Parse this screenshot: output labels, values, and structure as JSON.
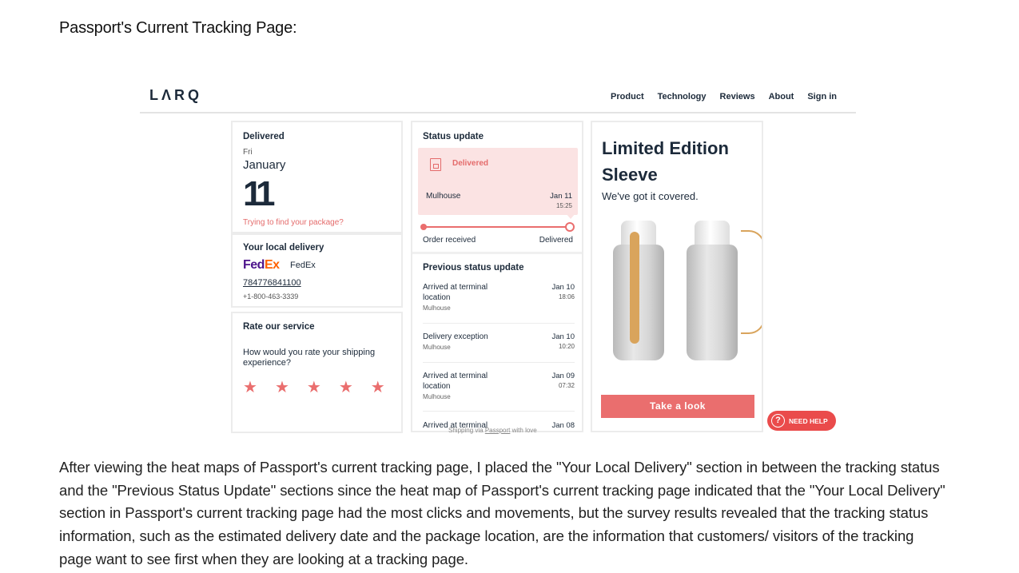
{
  "heading": "Passport's Current Tracking Page:",
  "site": {
    "logo": "LΛRQ",
    "nav": [
      "Product",
      "Technology",
      "Reviews",
      "About",
      "Sign in"
    ]
  },
  "delivered_card": {
    "title": "Delivered",
    "day": "Fri",
    "month": "January",
    "date": "11",
    "help_link": "Trying to find your package?"
  },
  "local_delivery": {
    "title": "Your local delivery",
    "carrier_logo_fe": "Fed",
    "carrier_logo_ex": "Ex",
    "carrier_name": "FedEx",
    "tracking_number": "784776841100",
    "phone": "+1-800-463-3339"
  },
  "rating": {
    "title": "Rate our service",
    "question": "How would you rate your shipping experience?",
    "stars": 5
  },
  "status": {
    "title": "Status update",
    "current_label": "Delivered",
    "location": "Mulhouse",
    "date": "Jan 11",
    "time": "15:25",
    "progress_start": "Order received",
    "progress_end": "Delivered",
    "progress": 1.0,
    "previous_title": "Previous status update",
    "events": [
      {
        "desc": "Arrived at terminal location",
        "loc": "Mulhouse",
        "date": "Jan 10",
        "time": "18:06"
      },
      {
        "desc": "Delivery exception",
        "loc": "Mulhouse",
        "date": "Jan 10",
        "time": "10:20"
      },
      {
        "desc": "Arrived at terminal location",
        "loc": "Mulhouse",
        "date": "Jan 09",
        "time": "07:32"
      },
      {
        "desc": "Arrived at terminal",
        "loc": "",
        "date": "Jan 08",
        "time": ""
      }
    ],
    "shipping_prefix": "Shipping via ",
    "shipping_link": "Passport",
    "shipping_suffix": " with love"
  },
  "promo": {
    "title": "Limited Edition Sleeve",
    "subtitle": "We've got it covered.",
    "cta": "Take a look"
  },
  "help_button": {
    "icon": "?",
    "label": "NEED HELP"
  },
  "paragraph": "After viewing the heat maps of Passport's current tracking page, I placed the \"Your Local Delivery\" section in between the tracking status and the \"Previous Status Update\" sections since the heat map of Passport's current tracking page indicated that the \"Your Local Delivery\" section in Passport's current tracking page had the most clicks and movements, but the survey results revealed that the tracking status information, such as the estimated delivery date and the package location, are the information that customers/ visitors of the tracking page want to see first when they are looking at a tracking page.",
  "colors": {
    "accent": "#ea6e6e",
    "navy": "#1c2a3a",
    "status_bg": "#fbe3e3"
  }
}
